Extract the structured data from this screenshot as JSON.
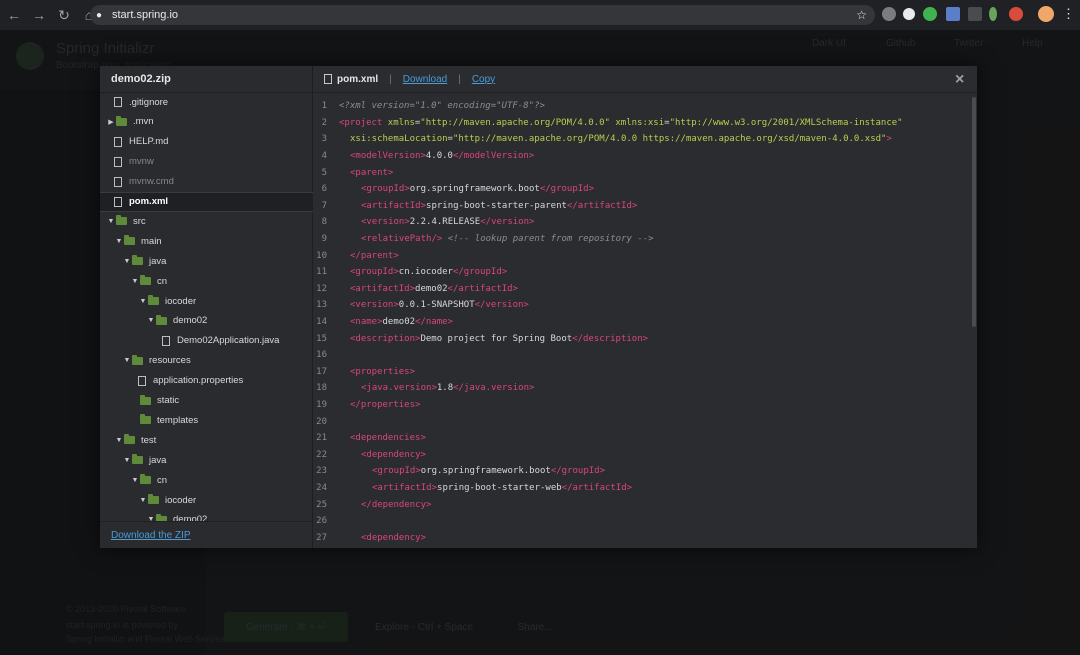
{
  "browser": {
    "url": "start.spring.io",
    "back": "←",
    "forward": "→",
    "reload": "↻",
    "home": "⌂",
    "lock": "🔒",
    "star": "☆",
    "menu": "⋮"
  },
  "background_page": {
    "title": "Spring Initializr",
    "subtitle": "Bootstrap your application",
    "nav": [
      "Dark UI",
      "Github",
      "Twitter",
      "Help"
    ],
    "buttons": [
      "Generate - ⌘ + ⏎",
      "Explore - Ctrl + Space",
      "Share..."
    ],
    "footer": [
      "© 2013-2020 Pivotal Software",
      "start.spring.io is powered by",
      "Spring Initializr and Pivotal Web Services"
    ]
  },
  "explorer": {
    "archive_name": "demo02.zip",
    "download_zip": "Download the ZIP",
    "tree": [
      {
        "label": ".gitignore",
        "type": "file",
        "depth": 1,
        "dim": false
      },
      {
        "label": ".mvn",
        "type": "folder",
        "depth": 0,
        "collapsed": true,
        "dim": false
      },
      {
        "label": "HELP.md",
        "type": "file",
        "depth": 1,
        "dim": false
      },
      {
        "label": "mvnw",
        "type": "file",
        "depth": 1,
        "dim": true
      },
      {
        "label": "mvnw.cmd",
        "type": "file",
        "depth": 1,
        "dim": true
      },
      {
        "label": "pom.xml",
        "type": "file",
        "depth": 1,
        "selected": true
      },
      {
        "label": "src",
        "type": "folder",
        "depth": 0
      },
      {
        "label": "main",
        "type": "folder",
        "depth": 1
      },
      {
        "label": "java",
        "type": "folder",
        "depth": 2
      },
      {
        "label": "cn",
        "type": "folder",
        "depth": 3
      },
      {
        "label": "iocoder",
        "type": "folder",
        "depth": 4
      },
      {
        "label": "demo02",
        "type": "folder",
        "depth": 5
      },
      {
        "label": "Demo02Application.java",
        "type": "file",
        "depth": 7
      },
      {
        "label": "resources",
        "type": "folder",
        "depth": 2
      },
      {
        "label": "application.properties",
        "type": "file",
        "depth": 4
      },
      {
        "label": "static",
        "type": "folder",
        "depth": 3,
        "nocaret": true
      },
      {
        "label": "templates",
        "type": "folder",
        "depth": 3,
        "nocaret": true
      },
      {
        "label": "test",
        "type": "folder",
        "depth": 1
      },
      {
        "label": "java",
        "type": "folder",
        "depth": 2
      },
      {
        "label": "cn",
        "type": "folder",
        "depth": 3
      },
      {
        "label": "iocoder",
        "type": "folder",
        "depth": 4
      },
      {
        "label": "demo02",
        "type": "folder",
        "depth": 5
      }
    ]
  },
  "editor": {
    "file_name": "pom.xml",
    "download_label": "Download",
    "copy_label": "Copy",
    "close": "×",
    "lines": [
      {
        "n": "1",
        "indent": 0,
        "parts": [
          [
            "cm",
            "<?xml version=\"1.0\" encoding=\"UTF-8\"?>"
          ]
        ]
      },
      {
        "n": "2",
        "indent": 0,
        "parts": [
          [
            "tag",
            "<project"
          ],
          [
            "txt",
            " "
          ],
          [
            "attr",
            "xmlns"
          ],
          [
            "txt",
            "="
          ],
          [
            "val",
            "\"http://maven.apache.org/POM/4.0.0\""
          ],
          [
            "txt",
            " "
          ],
          [
            "attr",
            "xmlns:xsi"
          ],
          [
            "txt",
            "="
          ],
          [
            "val",
            "\"http://www.w3.org/2001/XMLSchema-instance\""
          ]
        ]
      },
      {
        "n": "3",
        "indent": 1,
        "parts": [
          [
            "attr",
            "xsi:schemaLocation"
          ],
          [
            "txt",
            "="
          ],
          [
            "val",
            "\"http://maven.apache.org/POM/4.0.0 https://maven.apache.org/xsd/maven-4.0.0.xsd\""
          ],
          [
            "tag",
            ">"
          ]
        ]
      },
      {
        "n": "4",
        "indent": 1,
        "parts": [
          [
            "tag",
            "<modelVersion>"
          ],
          [
            "txt",
            "4.0.0"
          ],
          [
            "tag",
            "</modelVersion>"
          ]
        ]
      },
      {
        "n": "5",
        "indent": 1,
        "parts": [
          [
            "tag",
            "<parent>"
          ]
        ]
      },
      {
        "n": "6",
        "indent": 2,
        "parts": [
          [
            "tag",
            "<groupId>"
          ],
          [
            "txt",
            "org.springframework.boot"
          ],
          [
            "tag",
            "</groupId>"
          ]
        ]
      },
      {
        "n": "7",
        "indent": 2,
        "parts": [
          [
            "tag",
            "<artifactId>"
          ],
          [
            "txt",
            "spring-boot-starter-parent"
          ],
          [
            "tag",
            "</artifactId>"
          ]
        ]
      },
      {
        "n": "8",
        "indent": 2,
        "parts": [
          [
            "tag",
            "<version>"
          ],
          [
            "txt",
            "2.2.4.RELEASE"
          ],
          [
            "tag",
            "</version>"
          ]
        ]
      },
      {
        "n": "9",
        "indent": 2,
        "parts": [
          [
            "tag",
            "<relativePath/>"
          ],
          [
            "txt",
            " "
          ],
          [
            "cm",
            "<!-- lookup parent from repository -->"
          ]
        ]
      },
      {
        "n": "10",
        "indent": 1,
        "parts": [
          [
            "tag",
            "</parent>"
          ]
        ]
      },
      {
        "n": "11",
        "indent": 1,
        "parts": [
          [
            "tag",
            "<groupId>"
          ],
          [
            "txt",
            "cn.iocoder"
          ],
          [
            "tag",
            "</groupId>"
          ]
        ]
      },
      {
        "n": "12",
        "indent": 1,
        "parts": [
          [
            "tag",
            "<artifactId>"
          ],
          [
            "txt",
            "demo02"
          ],
          [
            "tag",
            "</artifactId>"
          ]
        ]
      },
      {
        "n": "13",
        "indent": 1,
        "parts": [
          [
            "tag",
            "<version>"
          ],
          [
            "txt",
            "0.0.1-SNAPSHOT"
          ],
          [
            "tag",
            "</version>"
          ]
        ]
      },
      {
        "n": "14",
        "indent": 1,
        "parts": [
          [
            "tag",
            "<name>"
          ],
          [
            "txt",
            "demo02"
          ],
          [
            "tag",
            "</name>"
          ]
        ]
      },
      {
        "n": "15",
        "indent": 1,
        "parts": [
          [
            "tag",
            "<description>"
          ],
          [
            "txt",
            "Demo project for Spring Boot"
          ],
          [
            "tag",
            "</description>"
          ]
        ]
      },
      {
        "n": "16",
        "indent": 0,
        "parts": []
      },
      {
        "n": "17",
        "indent": 1,
        "parts": [
          [
            "tag",
            "<properties>"
          ]
        ]
      },
      {
        "n": "18",
        "indent": 2,
        "parts": [
          [
            "tag",
            "<java.version>"
          ],
          [
            "txt",
            "1.8"
          ],
          [
            "tag",
            "</java.version>"
          ]
        ]
      },
      {
        "n": "19",
        "indent": 1,
        "parts": [
          [
            "tag",
            "</properties>"
          ]
        ]
      },
      {
        "n": "20",
        "indent": 0,
        "parts": []
      },
      {
        "n": "21",
        "indent": 1,
        "parts": [
          [
            "tag",
            "<dependencies>"
          ]
        ]
      },
      {
        "n": "22",
        "indent": 2,
        "parts": [
          [
            "tag",
            "<dependency>"
          ]
        ]
      },
      {
        "n": "23",
        "indent": 3,
        "parts": [
          [
            "tag",
            "<groupId>"
          ],
          [
            "txt",
            "org.springframework.boot"
          ],
          [
            "tag",
            "</groupId>"
          ]
        ]
      },
      {
        "n": "24",
        "indent": 3,
        "parts": [
          [
            "tag",
            "<artifactId>"
          ],
          [
            "txt",
            "spring-boot-starter-web"
          ],
          [
            "tag",
            "</artifactId>"
          ]
        ]
      },
      {
        "n": "25",
        "indent": 2,
        "parts": [
          [
            "tag",
            "</dependency>"
          ]
        ]
      },
      {
        "n": "26",
        "indent": 0,
        "parts": []
      },
      {
        "n": "27",
        "indent": 2,
        "parts": [
          [
            "tag",
            "<dependency>"
          ]
        ]
      }
    ]
  },
  "colors": {
    "tag": "#d8467a",
    "attr_value": "#b7cf4e",
    "comment": "#8d8d8d",
    "link": "#4a9bd6",
    "folder": "#5f8a3a"
  }
}
